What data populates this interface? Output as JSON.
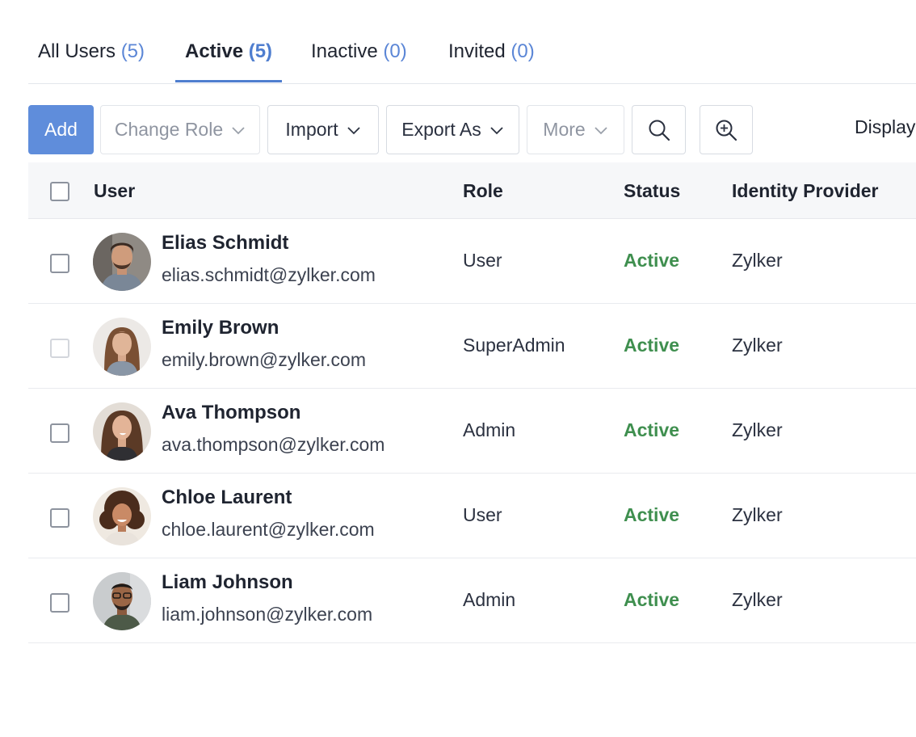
{
  "tabs": [
    {
      "label": "All Users",
      "count": "(5)"
    },
    {
      "label": "Active",
      "count": "(5)"
    },
    {
      "label": "Inactive",
      "count": "(0)"
    },
    {
      "label": "Invited",
      "count": "(0)"
    }
  ],
  "toolbar": {
    "add": "Add",
    "change_role": "Change Role",
    "import": "Import",
    "export_as": "Export As",
    "more": "More",
    "display": "Display"
  },
  "table": {
    "headers": {
      "user": "User",
      "role": "Role",
      "status": "Status",
      "identity_provider": "Identity Provider"
    },
    "rows": [
      {
        "name": "Elias Schmidt",
        "email": "elias.schmidt@zylker.com",
        "role": "User",
        "status": "Active",
        "idp": "Zylker"
      },
      {
        "name": "Emily Brown",
        "email": "emily.brown@zylker.com",
        "role": "SuperAdmin",
        "status": "Active",
        "idp": "Zylker"
      },
      {
        "name": "Ava Thompson",
        "email": "ava.thompson@zylker.com",
        "role": "Admin",
        "status": "Active",
        "idp": "Zylker"
      },
      {
        "name": "Chloe Laurent",
        "email": "chloe.laurent@zylker.com",
        "role": "User",
        "status": "Active",
        "idp": "Zylker"
      },
      {
        "name": "Liam Johnson",
        "email": "liam.johnson@zylker.com",
        "role": "Admin",
        "status": "Active",
        "idp": "Zylker"
      }
    ]
  },
  "colors": {
    "accent": "#4f7ecf",
    "primary_button": "#5f8ddb",
    "status_active": "#3f8f4f"
  },
  "icons": [
    "chevron-down-icon",
    "search-icon",
    "zoom-in-icon",
    "avatar"
  ]
}
